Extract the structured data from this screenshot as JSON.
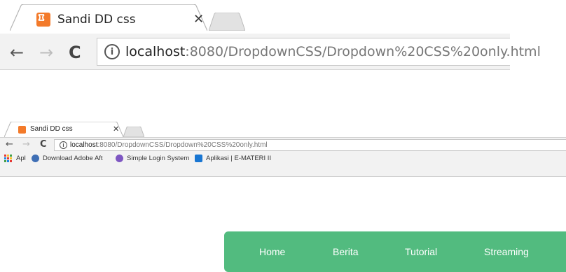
{
  "large_browser": {
    "tab": {
      "title": "Sandi DD css",
      "close_glyph": "✕",
      "favicon": "xampp-icon"
    },
    "toolbar": {
      "back_glyph": "←",
      "forward_glyph": "→",
      "reload_glyph": "C",
      "info_glyph": "i",
      "url_host": "localhost",
      "url_rest": ":8080/DropdownCSS/Dropdown%20CSS%20only.html"
    }
  },
  "small_browser": {
    "tab": {
      "title": "Sandi DD css",
      "close_glyph": "✕",
      "favicon": "xampp-icon"
    },
    "toolbar": {
      "back_glyph": "←",
      "forward_glyph": "→",
      "reload_glyph": "C",
      "info_glyph": "i",
      "url_host": "localhost",
      "url_rest": ":8080/DropdownCSS/Dropdown%20CSS%20only.html"
    },
    "bookmarks": [
      {
        "label": "Apl",
        "icon": "apps-grid-icon"
      },
      {
        "label": "Download Adobe Aft",
        "icon": "download-site-icon"
      },
      {
        "label": "Simple Login System",
        "icon": "login-system-icon"
      },
      {
        "label": "Aplikasi | E-MATERI II",
        "icon": "aplikasi-site-icon"
      }
    ]
  },
  "navbar": {
    "color": "#52bb7f",
    "items": [
      "Home",
      "Berita",
      "Tutorial",
      "Streaming"
    ]
  },
  "colors": {
    "favicon": "#f37a2a",
    "toolbar_bg": "#f2f2f2"
  }
}
